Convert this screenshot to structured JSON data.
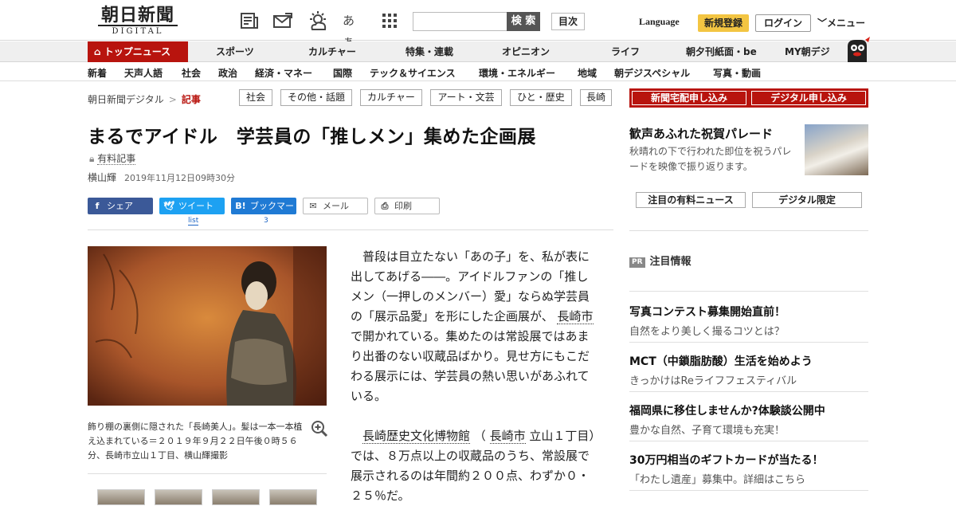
{
  "header": {
    "logo_jp": "朝日新聞",
    "logo_en": "DIGITAL",
    "icons": [
      "newspaper-icon",
      "mail-icon",
      "weather-icon",
      "font-size-icon",
      "grid-menu-icon"
    ],
    "font_icon_text": "あぁ",
    "search_placeholder": "",
    "search_button": "検 索",
    "toc_button": "目次",
    "language": "Language",
    "register": "新規登録",
    "login": "ログイン",
    "menu": "メニュー"
  },
  "gnav": [
    "トップニュース",
    "スポーツ",
    "カルチャー",
    "特集・連載",
    "オピニオン",
    "ライフ",
    "朝夕刊紙面・be",
    "MY朝デジ"
  ],
  "snav": [
    "新着",
    "天声人語",
    "社会",
    "政治",
    "経済・マネー",
    "国際",
    "テック＆サイエンス",
    "環境・エネルギー",
    "地域",
    "朝デジスペシャル",
    "写真・動画"
  ],
  "breadcrumb": {
    "home": "朝日新聞デジタル",
    "sep": ">",
    "current": "記事"
  },
  "tags": [
    "社会",
    "その他・話題",
    "カルチャー",
    "アート・文芸",
    "ひと・歴史",
    "長崎"
  ],
  "subscribe": {
    "paper": "新聞宅配申し込み",
    "digital": "デジタル申し込み"
  },
  "article": {
    "title": "まるでアイドル　学芸員の「推しメン」集めた企画展",
    "paid_label": "有料記事",
    "author": "横山輝",
    "date": "2019年11月12日09時30分",
    "share": {
      "facebook": "シェア",
      "twitter": "ツイート",
      "hatena": "ブックマーク",
      "mail": "メール",
      "print": "印刷",
      "twitter_count": "list",
      "hatena_count": "3"
    },
    "caption": "飾り棚の裏側に隠された「長崎美人」。髪は一本一本植え込まれている＝２０１９年９月２２日午後０時５６分、長崎市立山１丁目、横山輝撮影",
    "p1_a": "普段は目立たない「あの子」を、私が表に出してあげる――。アイドルファンの「推しメン（一押しのメンバー）愛」ならぬ学芸員の「展示品愛」を形にした企画展が、",
    "p1_link": "長崎市",
    "p1_b": "で開かれている。集めたのは常設展ではあまり出番のない収蔵品ばかり。見せ方にもこだわる展示には、学芸員の熱い思いがあふれている。",
    "p2_link1": "長崎歴史文化博物館",
    "p2_a": "（",
    "p2_link2": "長崎市",
    "p2_b": "立山１丁目）では、８万点以上の収蔵品のうち、常設展で展示されるのは年間約２００点、わずか０・２５％だ。"
  },
  "sidebar": {
    "feature_title": "歓声あふれた祝賀パレード",
    "feature_text": "秋晴れの下で行われた即位を祝うパレードを映像で振り返ります。",
    "btn_paid": "注目の有料ニュース",
    "btn_digital": "デジタル限定",
    "pr_badge": "PR",
    "pr_title": "注目情報",
    "pr_items": [
      {
        "title": "写真コンテスト募集開始直前！",
        "sub": "自然をより美しく撮るコツとは？"
      },
      {
        "title": "MCT（中鎖脂肪酸）生活を始めよう",
        "sub": "きっかけはReライフフェスティバル"
      },
      {
        "title": "福岡県に移住しませんか?体験談公開中",
        "sub": "豊かな自然、子育て環境も充実！"
      },
      {
        "title": "30万円相当のギフトカードが当たる！",
        "sub": "「わたし遺産」募集中。詳細はこちら"
      }
    ]
  },
  "colors": {
    "brand_red": "#b8140e",
    "register_yellow": "#f3c542",
    "facebook": "#3b5998",
    "twitter": "#1da1f2",
    "hatena": "#1f7ad4"
  }
}
